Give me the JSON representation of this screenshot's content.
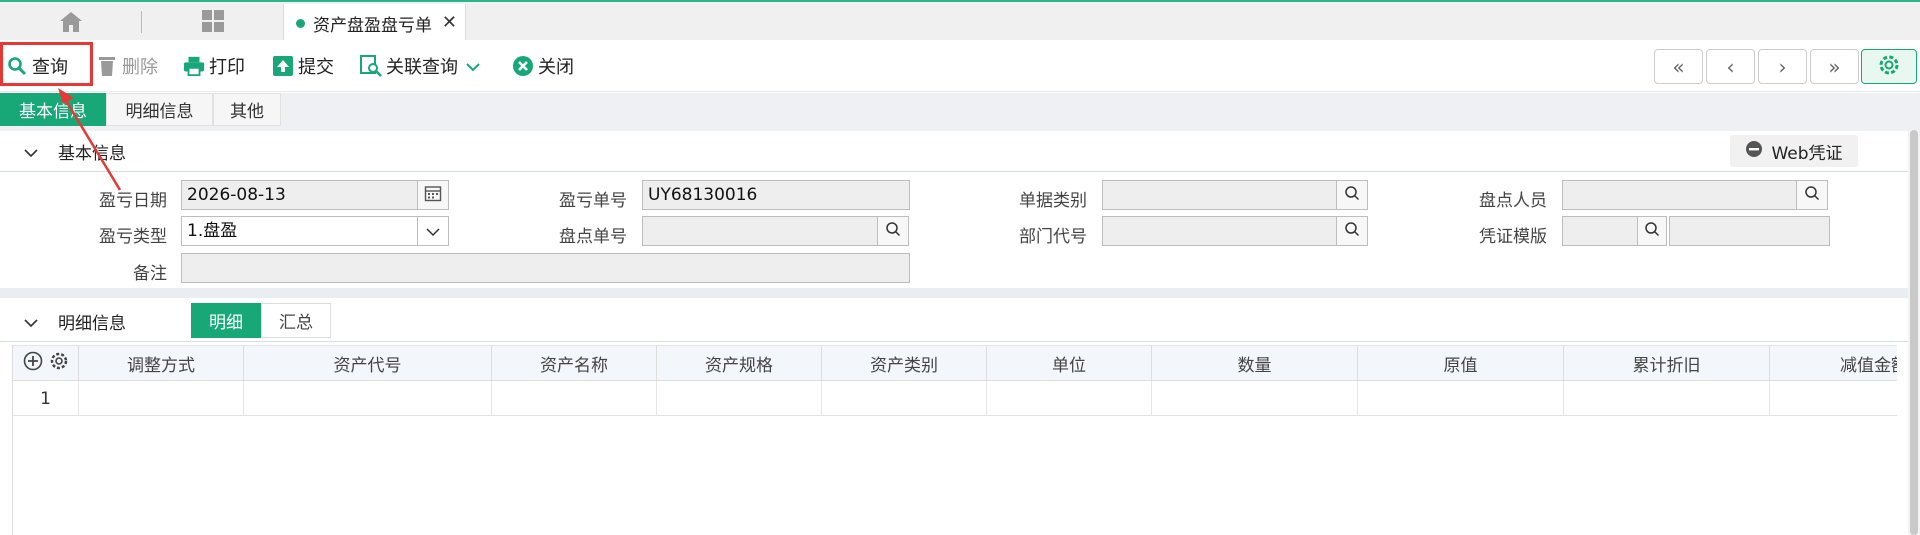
{
  "tabbar": {
    "active_tab": "资产盘盈盘亏单",
    "close_glyph": "✕"
  },
  "toolbar": {
    "query": "查询",
    "delete": "删除",
    "print": "打印",
    "submit": "提交",
    "related_query": "关联查询",
    "close": "关闭",
    "nav": {
      "first": "«",
      "prev": "‹",
      "next": "›",
      "last": "»"
    }
  },
  "subtabs": [
    "基本信息",
    "明细信息",
    "其他"
  ],
  "basic_section": {
    "title": "基本信息",
    "web_voucher": "Web凭证",
    "fields": {
      "date_label": "盈亏日期",
      "date_value": "2026-08-13",
      "no_label": "盈亏单号",
      "no_value": "UY68130016",
      "doc_type_label": "单据类别",
      "doc_type_value": "",
      "counter_label": "盘点人员",
      "counter_value": "",
      "type_label": "盈亏类型",
      "type_value": "1.盘盈",
      "count_no_label": "盘点单号",
      "count_no_value": "",
      "dept_label": "部门代号",
      "dept_value": "",
      "voucher_tpl_label": "凭证模版",
      "voucher_tpl_value": "",
      "remark_label": "备注",
      "remark_value": ""
    }
  },
  "detail_section": {
    "title": "明细信息",
    "tabs": [
      "明细",
      "汇总"
    ],
    "columns": [
      "调整方式",
      "资产代号",
      "资产名称",
      "资产规格",
      "资产类别",
      "单位",
      "数量",
      "原值",
      "累计折旧",
      "减值金额"
    ],
    "rows": [
      {
        "no": "1"
      }
    ]
  },
  "colors": {
    "accent": "#18a877",
    "highlight": "#e53935"
  }
}
